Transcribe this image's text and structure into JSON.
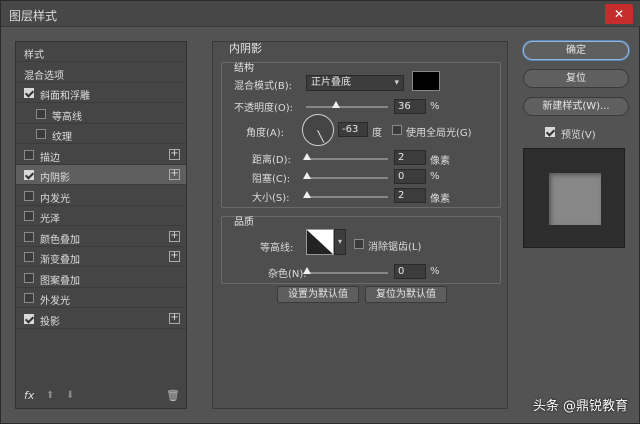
{
  "window": {
    "title": "图层样式",
    "close_glyph": "✕"
  },
  "left_panel": {
    "items": [
      {
        "label": "样式",
        "checkbox": false,
        "checked": false,
        "plus": false,
        "indent": 0,
        "selected": false
      },
      {
        "label": "混合选项",
        "checkbox": false,
        "checked": false,
        "plus": false,
        "indent": 0,
        "selected": false
      },
      {
        "label": "斜面和浮雕",
        "checkbox": true,
        "checked": true,
        "plus": false,
        "indent": 0,
        "selected": false
      },
      {
        "label": "等高线",
        "checkbox": true,
        "checked": false,
        "plus": false,
        "indent": 1,
        "selected": false
      },
      {
        "label": "纹理",
        "checkbox": true,
        "checked": false,
        "plus": false,
        "indent": 1,
        "selected": false
      },
      {
        "label": "描边",
        "checkbox": true,
        "checked": false,
        "plus": true,
        "indent": 0,
        "selected": false
      },
      {
        "label": "内阴影",
        "checkbox": true,
        "checked": true,
        "plus": true,
        "indent": 0,
        "selected": true
      },
      {
        "label": "内发光",
        "checkbox": true,
        "checked": false,
        "plus": false,
        "indent": 0,
        "selected": false
      },
      {
        "label": "光泽",
        "checkbox": true,
        "checked": false,
        "plus": false,
        "indent": 0,
        "selected": false
      },
      {
        "label": "颜色叠加",
        "checkbox": true,
        "checked": false,
        "plus": true,
        "indent": 0,
        "selected": false
      },
      {
        "label": "渐变叠加",
        "checkbox": true,
        "checked": false,
        "plus": true,
        "indent": 0,
        "selected": false
      },
      {
        "label": "图案叠加",
        "checkbox": true,
        "checked": false,
        "plus": false,
        "indent": 0,
        "selected": false
      },
      {
        "label": "外发光",
        "checkbox": true,
        "checked": false,
        "plus": false,
        "indent": 0,
        "selected": false
      },
      {
        "label": "投影",
        "checkbox": true,
        "checked": true,
        "plus": true,
        "indent": 0,
        "selected": false
      }
    ],
    "footer": {
      "fx": "fx",
      "up": "⬆",
      "down": "⬇",
      "trash": "🗑"
    }
  },
  "inner_shadow": {
    "section_title": "内阴影",
    "structure_title": "结构",
    "blend_mode_label": "混合模式(B):",
    "blend_mode_value": "正片叠底",
    "shadow_color": "#000000",
    "opacity_label": "不透明度(O):",
    "opacity_value": "36",
    "opacity_unit": "%",
    "angle_label": "角度(A):",
    "angle_value": "-63",
    "angle_unit": "度",
    "global_light_label": "使用全局光(G)",
    "global_light_checked": false,
    "distance_label": "距离(D):",
    "distance_value": "2",
    "distance_unit": "像素",
    "choke_label": "阻塞(C):",
    "choke_value": "0",
    "choke_unit": "%",
    "size_label": "大小(S):",
    "size_value": "2",
    "size_unit": "像素",
    "quality_title": "品质",
    "contour_label": "等高线:",
    "antialias_label": "消除锯齿(L)",
    "antialias_checked": false,
    "noise_label": "杂色(N):",
    "noise_value": "0",
    "noise_unit": "%",
    "set_default_label": "设置为默认值",
    "reset_default_label": "复位为默认值"
  },
  "right_panel": {
    "ok_label": "确定",
    "reset_label": "复位",
    "new_style_label": "新建样式(W)...",
    "preview_label": "预览(V)",
    "preview_checked": true
  },
  "watermark": "头条 @鼎锐教育"
}
